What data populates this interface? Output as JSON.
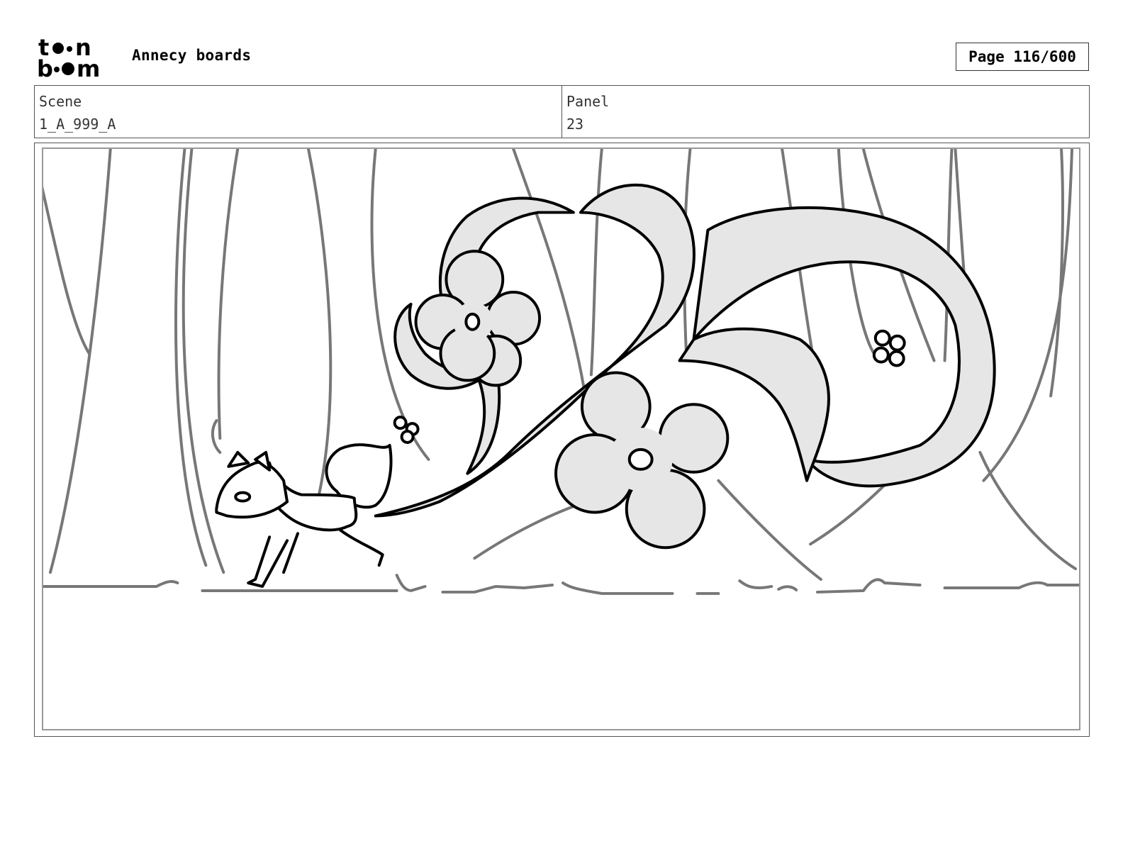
{
  "header": {
    "logo_text": "toon boom",
    "title": "Annecy boards",
    "page_label": "Page 116/600"
  },
  "info": {
    "scene_label": "Scene",
    "scene_value": "1_A_999_A",
    "panel_label": "Panel",
    "panel_value": "23"
  },
  "colors": {
    "sketch_line": "#000000",
    "tree_line": "#777777",
    "fill": "#e6e6e6"
  }
}
